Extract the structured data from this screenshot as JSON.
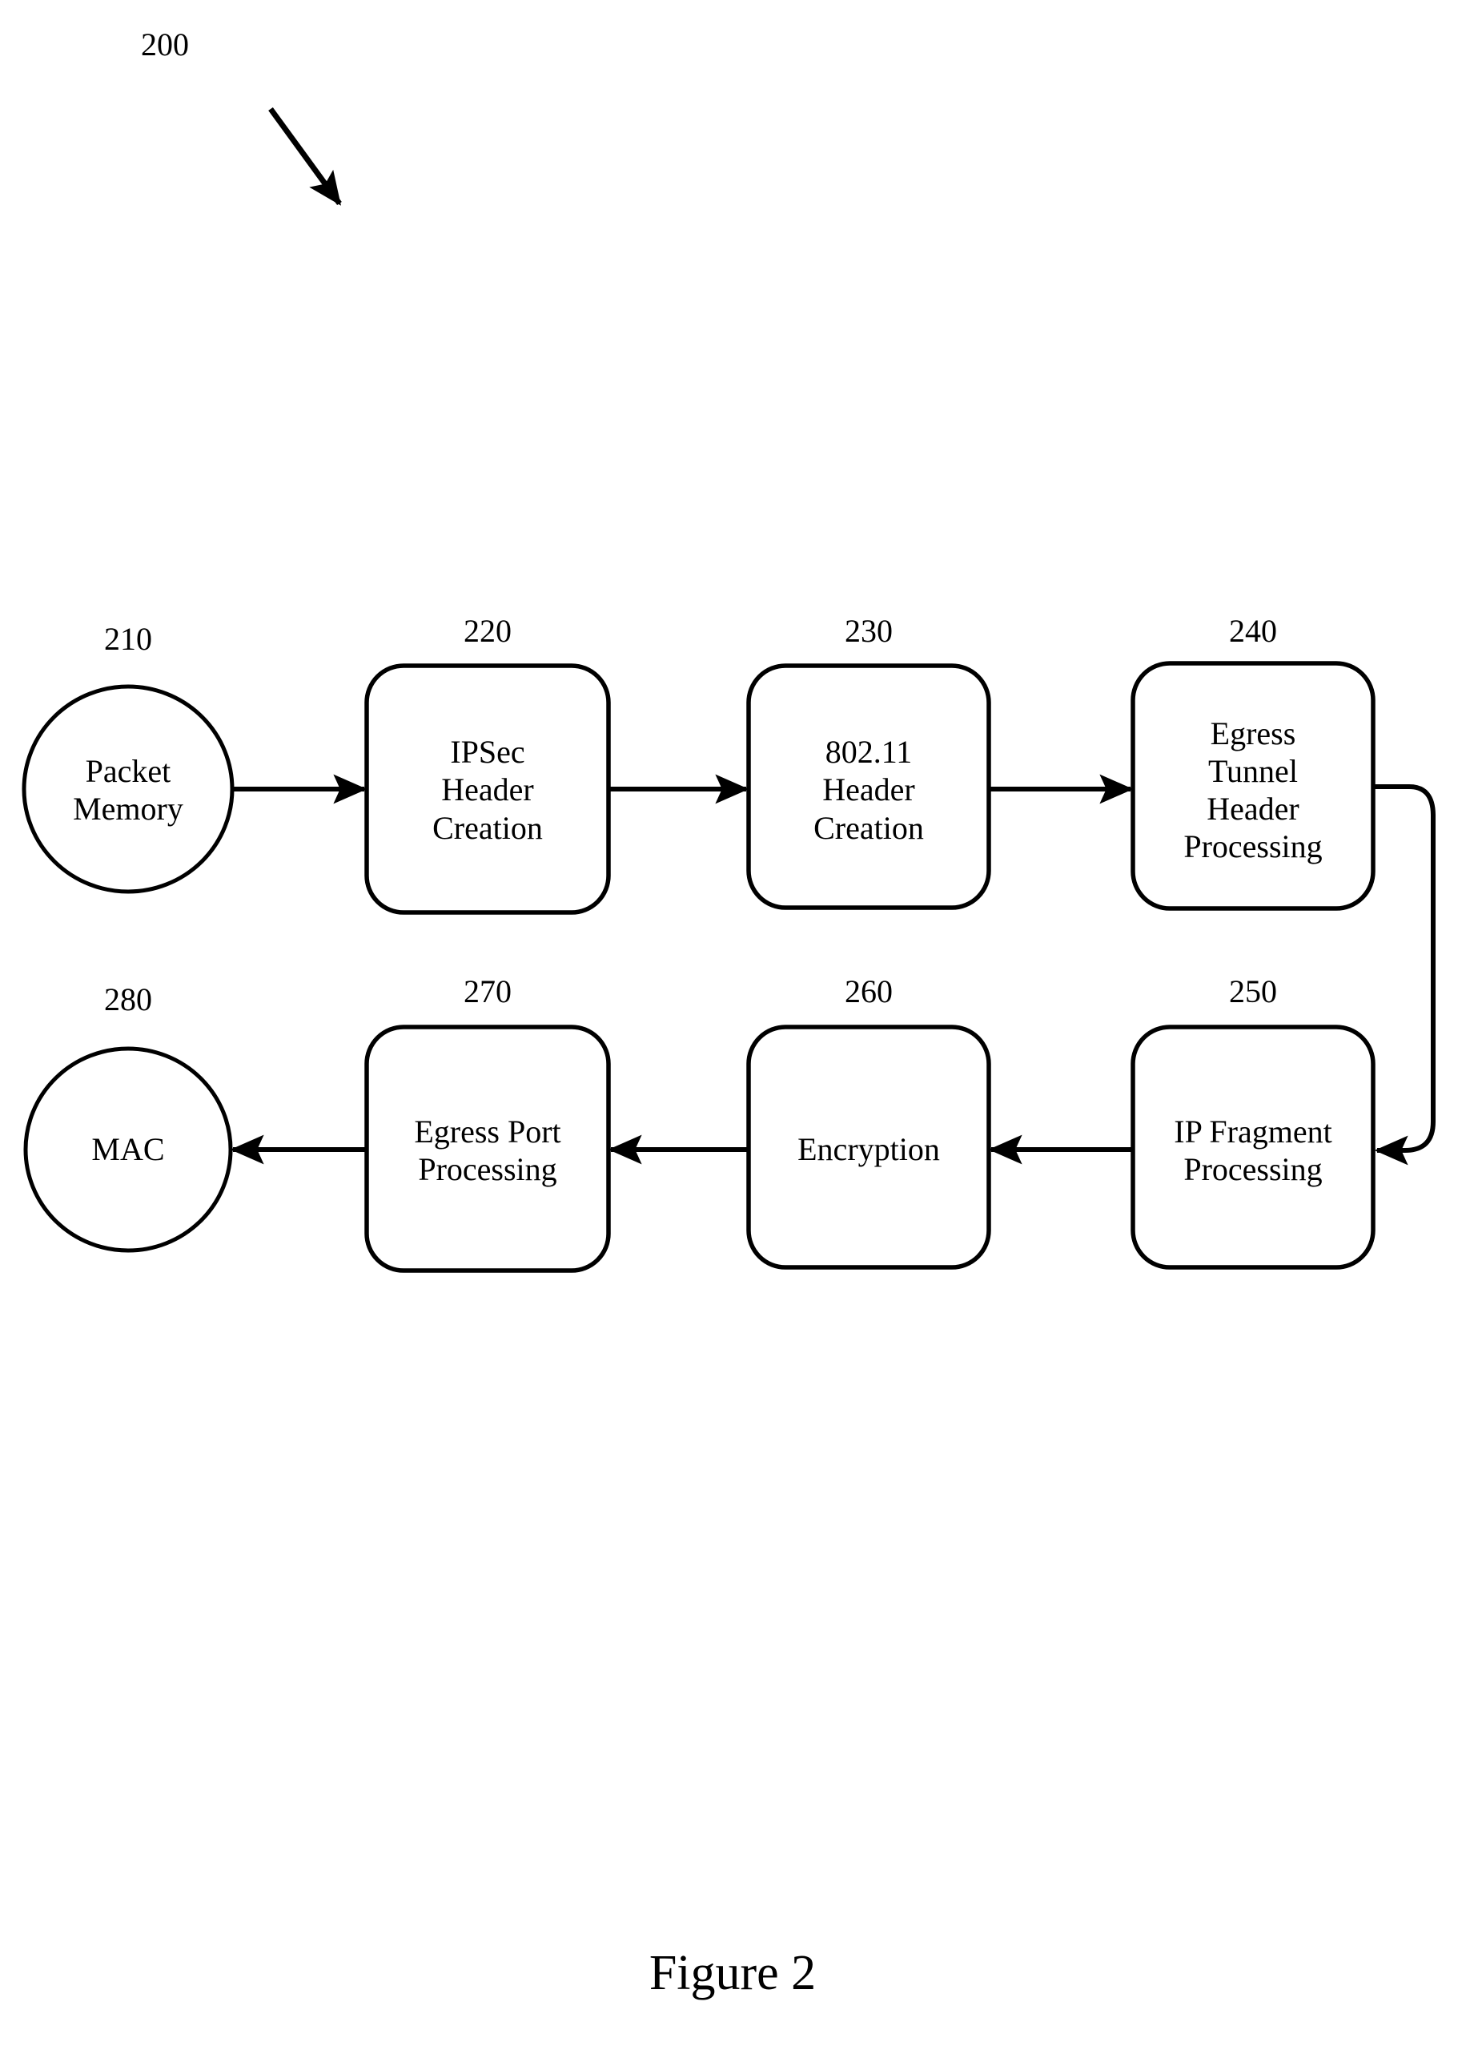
{
  "figure": {
    "caption": "Figure 2",
    "diagram_id": "200"
  },
  "nodes": [
    {
      "ref": "210",
      "shape": "circle",
      "lines": [
        "Packet",
        "Memory"
      ],
      "text": "Packet Memory"
    },
    {
      "ref": "220",
      "shape": "rounded-rect",
      "lines": [
        "IPSec",
        "Header",
        "Creation"
      ],
      "text": "IPSec Header Creation"
    },
    {
      "ref": "230",
      "shape": "rounded-rect",
      "lines": [
        "802.11",
        "Header",
        "Creation"
      ],
      "text": "802.11 Header Creation"
    },
    {
      "ref": "240",
      "shape": "rounded-rect",
      "lines": [
        "Egress",
        "Tunnel",
        "Header",
        "Processing"
      ],
      "text": "Egress Tunnel Header Processing"
    },
    {
      "ref": "250",
      "shape": "rounded-rect",
      "lines": [
        "IP Fragment",
        "Processing"
      ],
      "text": "IP Fragment Processing"
    },
    {
      "ref": "260",
      "shape": "rounded-rect",
      "lines": [
        "Encryption"
      ],
      "text": "Encryption"
    },
    {
      "ref": "270",
      "shape": "rounded-rect",
      "lines": [
        "Egress Port",
        "Processing"
      ],
      "text": "Egress Port Processing"
    },
    {
      "ref": "280",
      "shape": "circle",
      "lines": [
        "MAC"
      ],
      "text": "MAC"
    }
  ],
  "edges": [
    {
      "from": "210",
      "to": "220",
      "direction": "right"
    },
    {
      "from": "220",
      "to": "230",
      "direction": "right"
    },
    {
      "from": "230",
      "to": "240",
      "direction": "right"
    },
    {
      "from": "240",
      "to": "250",
      "direction": "wrap-right-down"
    },
    {
      "from": "250",
      "to": "260",
      "direction": "left"
    },
    {
      "from": "260",
      "to": "270",
      "direction": "left"
    },
    {
      "from": "270",
      "to": "280",
      "direction": "left"
    }
  ],
  "colors": {
    "stroke": "#000000",
    "background": "#ffffff"
  }
}
